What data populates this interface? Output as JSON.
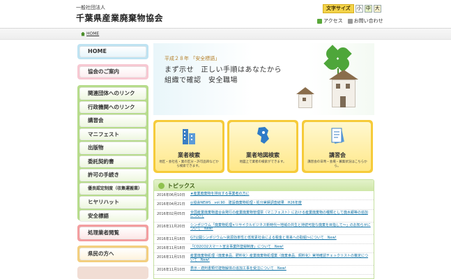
{
  "header": {
    "org_sub": "一般社団法人",
    "org_name": "千葉県産業廃棄物協会",
    "font_size_label": "文字サイズ",
    "font_size_small": "小",
    "font_size_mid": "中",
    "font_size_large": "大",
    "access_label": "アクセス",
    "contact_label": "お問い合わせ"
  },
  "breadcrumb": {
    "home": "HOME"
  },
  "sidebar": {
    "home": "HOME",
    "about": "協会のご案内",
    "green_items": [
      "関連団体へのリンク",
      "行政機関へのリンク",
      "講習会",
      "マニフェスト",
      "出版物",
      "委託契約書",
      "許可の手続き",
      "優良認定制度（収集運搬業）",
      "ヒヤリハット",
      "安全標語"
    ],
    "process": "処理業者閲覧",
    "citizen": "県民の方へ"
  },
  "hero": {
    "small": "平成２８年 「安全標語」",
    "line1": "まず示せ　正しい手順はあなたから",
    "line2": "組織で確認　安全職場"
  },
  "cards": [
    {
      "title": "業者検索",
      "desc": "地区・会社名・業の区分・許可品目などから検索できます。"
    },
    {
      "title": "業者地図検索",
      "desc": "地図上で業者の検索ができます。"
    },
    {
      "title": "講習会",
      "desc": "講習会の日時・会場・募集状況はこちらから。"
    }
  ],
  "topics": {
    "title": "トピックス",
    "items": [
      {
        "date": "2016年06月10日",
        "text": "★産業廃棄物を排出する事業者の方に"
      },
      {
        "date": "2016年04月21日",
        "text": "◎協会NEWS　vol.90　建設廃棄物処理・処分実績調査結果　H26年度"
      },
      {
        "date": "2016年02月05日",
        "text": "全国産業廃棄物連合会発行の産業廃棄物管理票（マニフェスト）における産業廃棄物の種類として廃水銀等の追加について"
      },
      {
        "date": "2016年11月20日",
        "text": "シンポジウム「廃棄物処理×リサイクルビジネス新時代〜地域の共生と持続可能な廃棄を目指して〜」のお知らせについて　New!"
      },
      {
        "date": "2016年11月18日",
        "text": "G7公開シンポジウム〜資源効率性と低炭素社会による税金と将来への取組〜について　New!"
      },
      {
        "date": "2016年11月18日",
        "text": "「CO2CO2スマート宣言事業所登録制度」について　New!"
      },
      {
        "date": "2016年11月15日",
        "text": "産業廃棄物処理（廃棄食品、肥料化）産業廃棄物処理業（廃棄食品、飼料化）実地確認チェックリストの策定について　New!"
      },
      {
        "date": "2016年11月10日",
        "text": "表示・適判書類付建物解体の追加工事を受注について　New!"
      }
    ]
  },
  "colors": {
    "sidebar_home": "#bfe3f2",
    "sidebar_about": "#f7c8d2",
    "sidebar_green": "#b7dc8c",
    "sidebar_process": "#f39ea0",
    "sidebar_citizen": "#f3cf7f",
    "card_accent": "#f6cb3a",
    "link": "#0c6fa3"
  }
}
